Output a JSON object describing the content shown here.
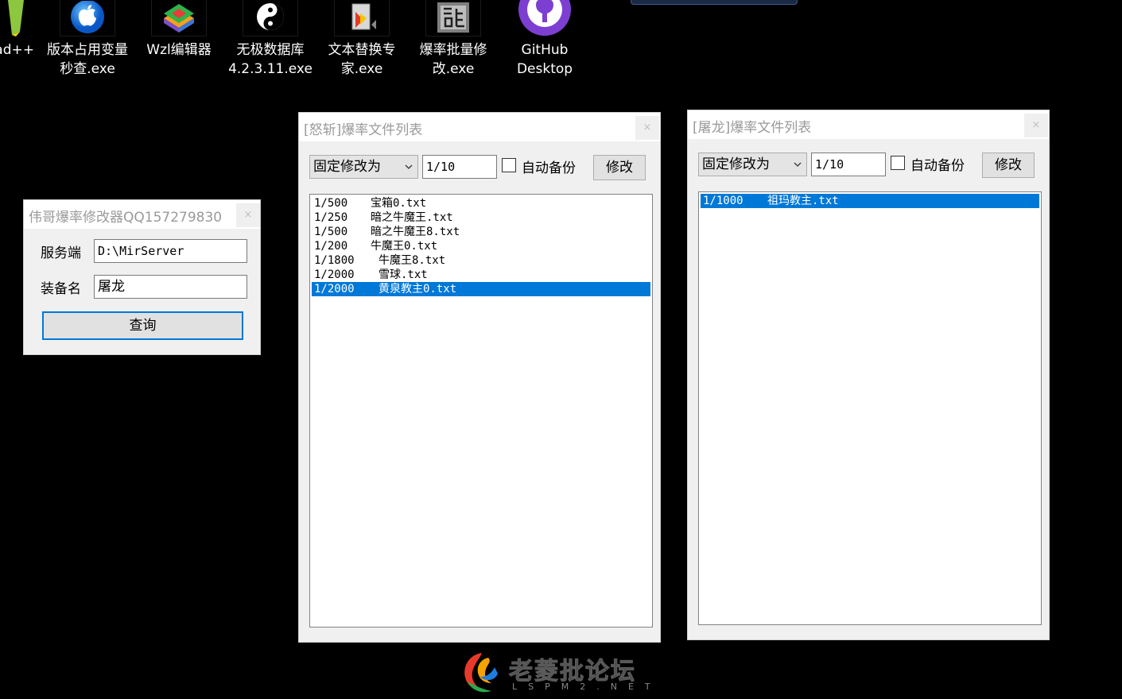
{
  "desktop": {
    "icons": [
      {
        "label": "ad++",
        "icon": "notepad-plus-plus-icon"
      },
      {
        "label": "版本占用变量\n秒查.exe",
        "icon": "apple-icon"
      },
      {
        "label": "Wzl编辑器",
        "icon": "stacked-layers-icon"
      },
      {
        "label": "无极数据库\n4.2.3.11.exe",
        "icon": "yin-yang-icon"
      },
      {
        "label": "文本替换专\n家.exe",
        "icon": "file-tool-icon"
      },
      {
        "label": "爆率批量修\n改.exe",
        "icon": "dragon-character-icon"
      },
      {
        "label": "GitHub\nDesktop",
        "icon": "github-icon"
      }
    ]
  },
  "main_window": {
    "title": "伟哥爆率修改器QQ157279830",
    "server_label": "服务端",
    "server_value": "D:\\MirServer",
    "equip_label": "装备名",
    "equip_value": "屠龙",
    "query_button": "查询",
    "close_symbol": "×"
  },
  "window_nuzhan": {
    "title": "[怒斩]爆率文件列表",
    "mode_select": "固定修改为",
    "rate_value": "1/10",
    "auto_backup_label": "自动备份",
    "auto_backup_checked": false,
    "modify_button": "修改",
    "close_symbol": "×",
    "files": [
      {
        "rate": "1/500",
        "name": "宝箱0.txt",
        "selected": false
      },
      {
        "rate": "1/250",
        "name": "暗之牛魔王.txt",
        "selected": false
      },
      {
        "rate": "1/500",
        "name": "暗之牛魔王8.txt",
        "selected": false
      },
      {
        "rate": "1/200",
        "name": "牛魔王0.txt",
        "selected": false
      },
      {
        "rate": "1/1800",
        "name": "牛魔王8.txt",
        "selected": false
      },
      {
        "rate": "1/2000",
        "name": "雪球.txt",
        "selected": false
      },
      {
        "rate": "1/2000",
        "name": "黄泉教主0.txt",
        "selected": true
      }
    ]
  },
  "window_tulong": {
    "title": "[屠龙]爆率文件列表",
    "mode_select": "固定修改为",
    "rate_value": "1/10",
    "auto_backup_label": "自动备份",
    "auto_backup_checked": false,
    "modify_button": "修改",
    "close_symbol": "×",
    "files": [
      {
        "rate": "1/1000",
        "name": "祖玛教主.txt",
        "selected": true
      }
    ]
  },
  "watermark": {
    "text": "老菱批论坛",
    "sub": "LSPM2.NET"
  },
  "colors": {
    "selection": "#0078d7",
    "focus_border": "#0078d7",
    "desktop_bg": "#000000"
  }
}
